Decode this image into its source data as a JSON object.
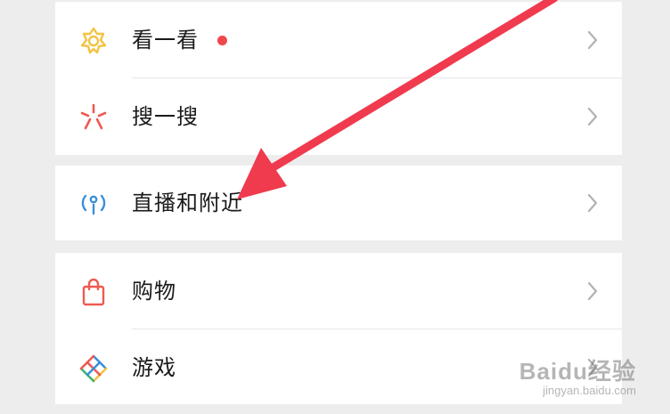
{
  "menu": {
    "items": [
      {
        "label": "看一看",
        "icon": "flower-star-icon",
        "has_dot": true
      },
      {
        "label": "搜一搜",
        "icon": "search-burst-icon",
        "has_dot": false
      },
      {
        "label": "直播和附近",
        "icon": "live-nearby-icon",
        "has_dot": false
      },
      {
        "label": "购物",
        "icon": "shopping-bag-icon",
        "has_dot": false
      },
      {
        "label": "游戏",
        "icon": "game-diamond-icon",
        "has_dot": false
      }
    ]
  },
  "colors": {
    "background": "#ededed",
    "card": "#ffffff",
    "dot": "#f0474b",
    "arrow": "#f03a4e",
    "kan_icon": "#f3c343",
    "sou_icon": "#ee5a52",
    "live_icon": "#3a8fd8",
    "shop_icon": "#ee5a52"
  },
  "watermark": {
    "main": "Baidu经验",
    "sub": "jingyan.baidu.com"
  }
}
